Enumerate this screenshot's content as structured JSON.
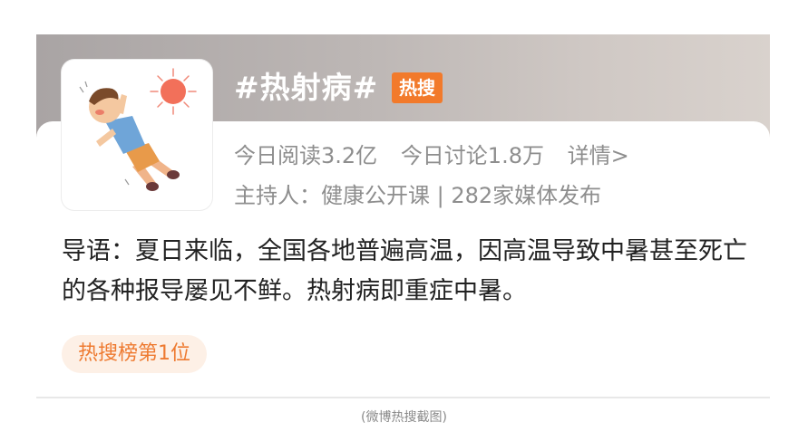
{
  "topic": {
    "title": "#热射病#",
    "badge": "热搜",
    "thumbnail": "heatstroke-illustration"
  },
  "stats": {
    "reads": "今日阅读3.2亿",
    "discussions": "今日讨论1.8万",
    "details_link": "详情>"
  },
  "host": {
    "text": "主持人：健康公开课 | 282家媒体发布"
  },
  "description": {
    "text": "导语：夏日来临，全国各地普遍高温，因高温导致中暑甚至死亡的各种报导屡见不鲜。热射病即重症中暑。"
  },
  "rank_tag": {
    "label": "热搜榜第1位"
  },
  "caption": {
    "text": "(微博热搜截图)"
  },
  "colors": {
    "header_gradient_start": "#a9a4a4",
    "header_gradient_end": "#d9d2cd",
    "badge": "#f27a2b",
    "rank_text": "#ee7a30",
    "rank_bg": "#fdf0e6",
    "meta_text": "#8e8e8e",
    "body_text": "#222222"
  }
}
